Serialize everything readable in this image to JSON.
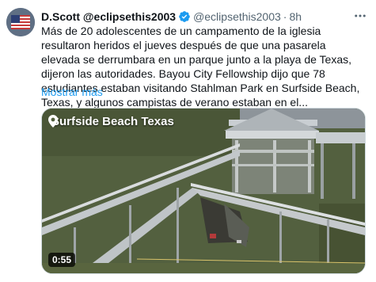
{
  "tweet": {
    "display_name": "D.Scott @eclipsethis2003",
    "handle": "@eclipsethis2003",
    "separator": "·",
    "time": "8h",
    "text": "Más de 20 adolescentes de un campamento de la iglesia resultaron heridos el jueves después de que una pasarela elevada se derrumbara en un parque junto a la playa de Texas, dijeron las autoridades. Bayou City Fellowship dijo que 78 estudiantes estaban visitando Stahlman Park en Surfside Beach, Texas, y algunos campistas de verano estaban en el...",
    "show_more": "Mostrar más",
    "media": {
      "location_text": "Surfside Beach Texas",
      "duration": "0:55"
    },
    "icons": {
      "verified": "verified-badge-icon",
      "more": "more-options-icon",
      "location": "location-pin-icon"
    },
    "colors": {
      "link": "#1d9bf0",
      "verified": "#1d9bf0",
      "secondary_text": "#536471"
    }
  }
}
